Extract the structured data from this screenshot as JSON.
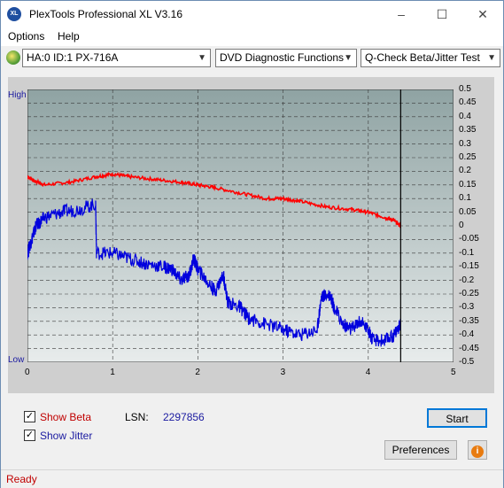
{
  "window": {
    "title": "PlexTools Professional XL V3.16",
    "icon_text": "XL",
    "minimize": "–",
    "maximize": "☐",
    "close": "✕"
  },
  "menu": {
    "options": "Options",
    "help": "Help"
  },
  "toolbar": {
    "drive": "HA:0 ID:1  PX-716A",
    "function": "DVD Diagnostic Functions",
    "test": "Q-Check Beta/Jitter Test"
  },
  "chart_data": {
    "type": "line",
    "left_axis": {
      "top_label": "High",
      "bottom_label": "Low"
    },
    "right_ticks": [
      "0.5",
      "0.45",
      "0.4",
      "0.35",
      "0.3",
      "0.25",
      "0.2",
      "0.15",
      "0.1",
      "0.05",
      "0",
      "-0.05",
      "-0.1",
      "-0.15",
      "-0.2",
      "-0.25",
      "-0.3",
      "-0.35",
      "-0.4",
      "-0.45",
      "-0.5"
    ],
    "x_ticks": [
      "0",
      "1",
      "2",
      "3",
      "4",
      "5"
    ],
    "xlim": [
      0,
      5
    ],
    "ylim": [
      -0.5,
      0.5
    ],
    "marker_x": 4.38,
    "series": [
      {
        "color": "#ff0000",
        "points": [
          [
            0,
            0.18
          ],
          [
            0.05,
            0.17
          ],
          [
            0.2,
            0.15
          ],
          [
            0.5,
            0.16
          ],
          [
            0.8,
            0.18
          ],
          [
            1.0,
            0.19
          ],
          [
            1.2,
            0.18
          ],
          [
            1.5,
            0.17
          ],
          [
            1.8,
            0.16
          ],
          [
            2.0,
            0.15
          ],
          [
            2.2,
            0.14
          ],
          [
            2.5,
            0.12
          ],
          [
            2.8,
            0.1
          ],
          [
            3.0,
            0.1
          ],
          [
            3.2,
            0.09
          ],
          [
            3.5,
            0.07
          ],
          [
            3.8,
            0.06
          ],
          [
            4.0,
            0.05
          ],
          [
            4.2,
            0.03
          ],
          [
            4.3,
            0.02
          ],
          [
            4.38,
            0.0
          ]
        ]
      },
      {
        "color": "#0000dd",
        "points": [
          [
            0,
            -0.1
          ],
          [
            0.05,
            -0.05
          ],
          [
            0.1,
            0.0
          ],
          [
            0.2,
            0.03
          ],
          [
            0.4,
            0.05
          ],
          [
            0.6,
            0.06
          ],
          [
            0.8,
            0.08
          ],
          [
            0.81,
            -0.1
          ],
          [
            1.0,
            -0.1
          ],
          [
            1.2,
            -0.12
          ],
          [
            1.4,
            -0.14
          ],
          [
            1.6,
            -0.15
          ],
          [
            1.7,
            -0.16
          ],
          [
            1.8,
            -0.2
          ],
          [
            1.9,
            -0.18
          ],
          [
            1.95,
            -0.12
          ],
          [
            2.0,
            -0.16
          ],
          [
            2.1,
            -0.2
          ],
          [
            2.2,
            -0.24
          ],
          [
            2.3,
            -0.18
          ],
          [
            2.35,
            -0.28
          ],
          [
            2.5,
            -0.3
          ],
          [
            2.6,
            -0.34
          ],
          [
            2.8,
            -0.36
          ],
          [
            3.0,
            -0.38
          ],
          [
            3.2,
            -0.4
          ],
          [
            3.4,
            -0.38
          ],
          [
            3.45,
            -0.26
          ],
          [
            3.55,
            -0.25
          ],
          [
            3.6,
            -0.3
          ],
          [
            3.7,
            -0.36
          ],
          [
            3.8,
            -0.38
          ],
          [
            3.9,
            -0.35
          ],
          [
            4.0,
            -0.38
          ],
          [
            4.05,
            -0.42
          ],
          [
            4.2,
            -0.42
          ],
          [
            4.3,
            -0.4
          ],
          [
            4.38,
            -0.36
          ]
        ]
      }
    ],
    "colors": {
      "background_top": "#8fa3a3",
      "background_bottom": "#e8ecec",
      "grid": "#3a3a3a"
    }
  },
  "options": {
    "show_beta": "Show Beta",
    "show_jitter": "Show Jitter",
    "lsn_label": "LSN:",
    "lsn_value": "2297856",
    "start": "Start",
    "preferences": "Preferences",
    "info_icon": "i"
  },
  "status": {
    "text": "Ready"
  }
}
